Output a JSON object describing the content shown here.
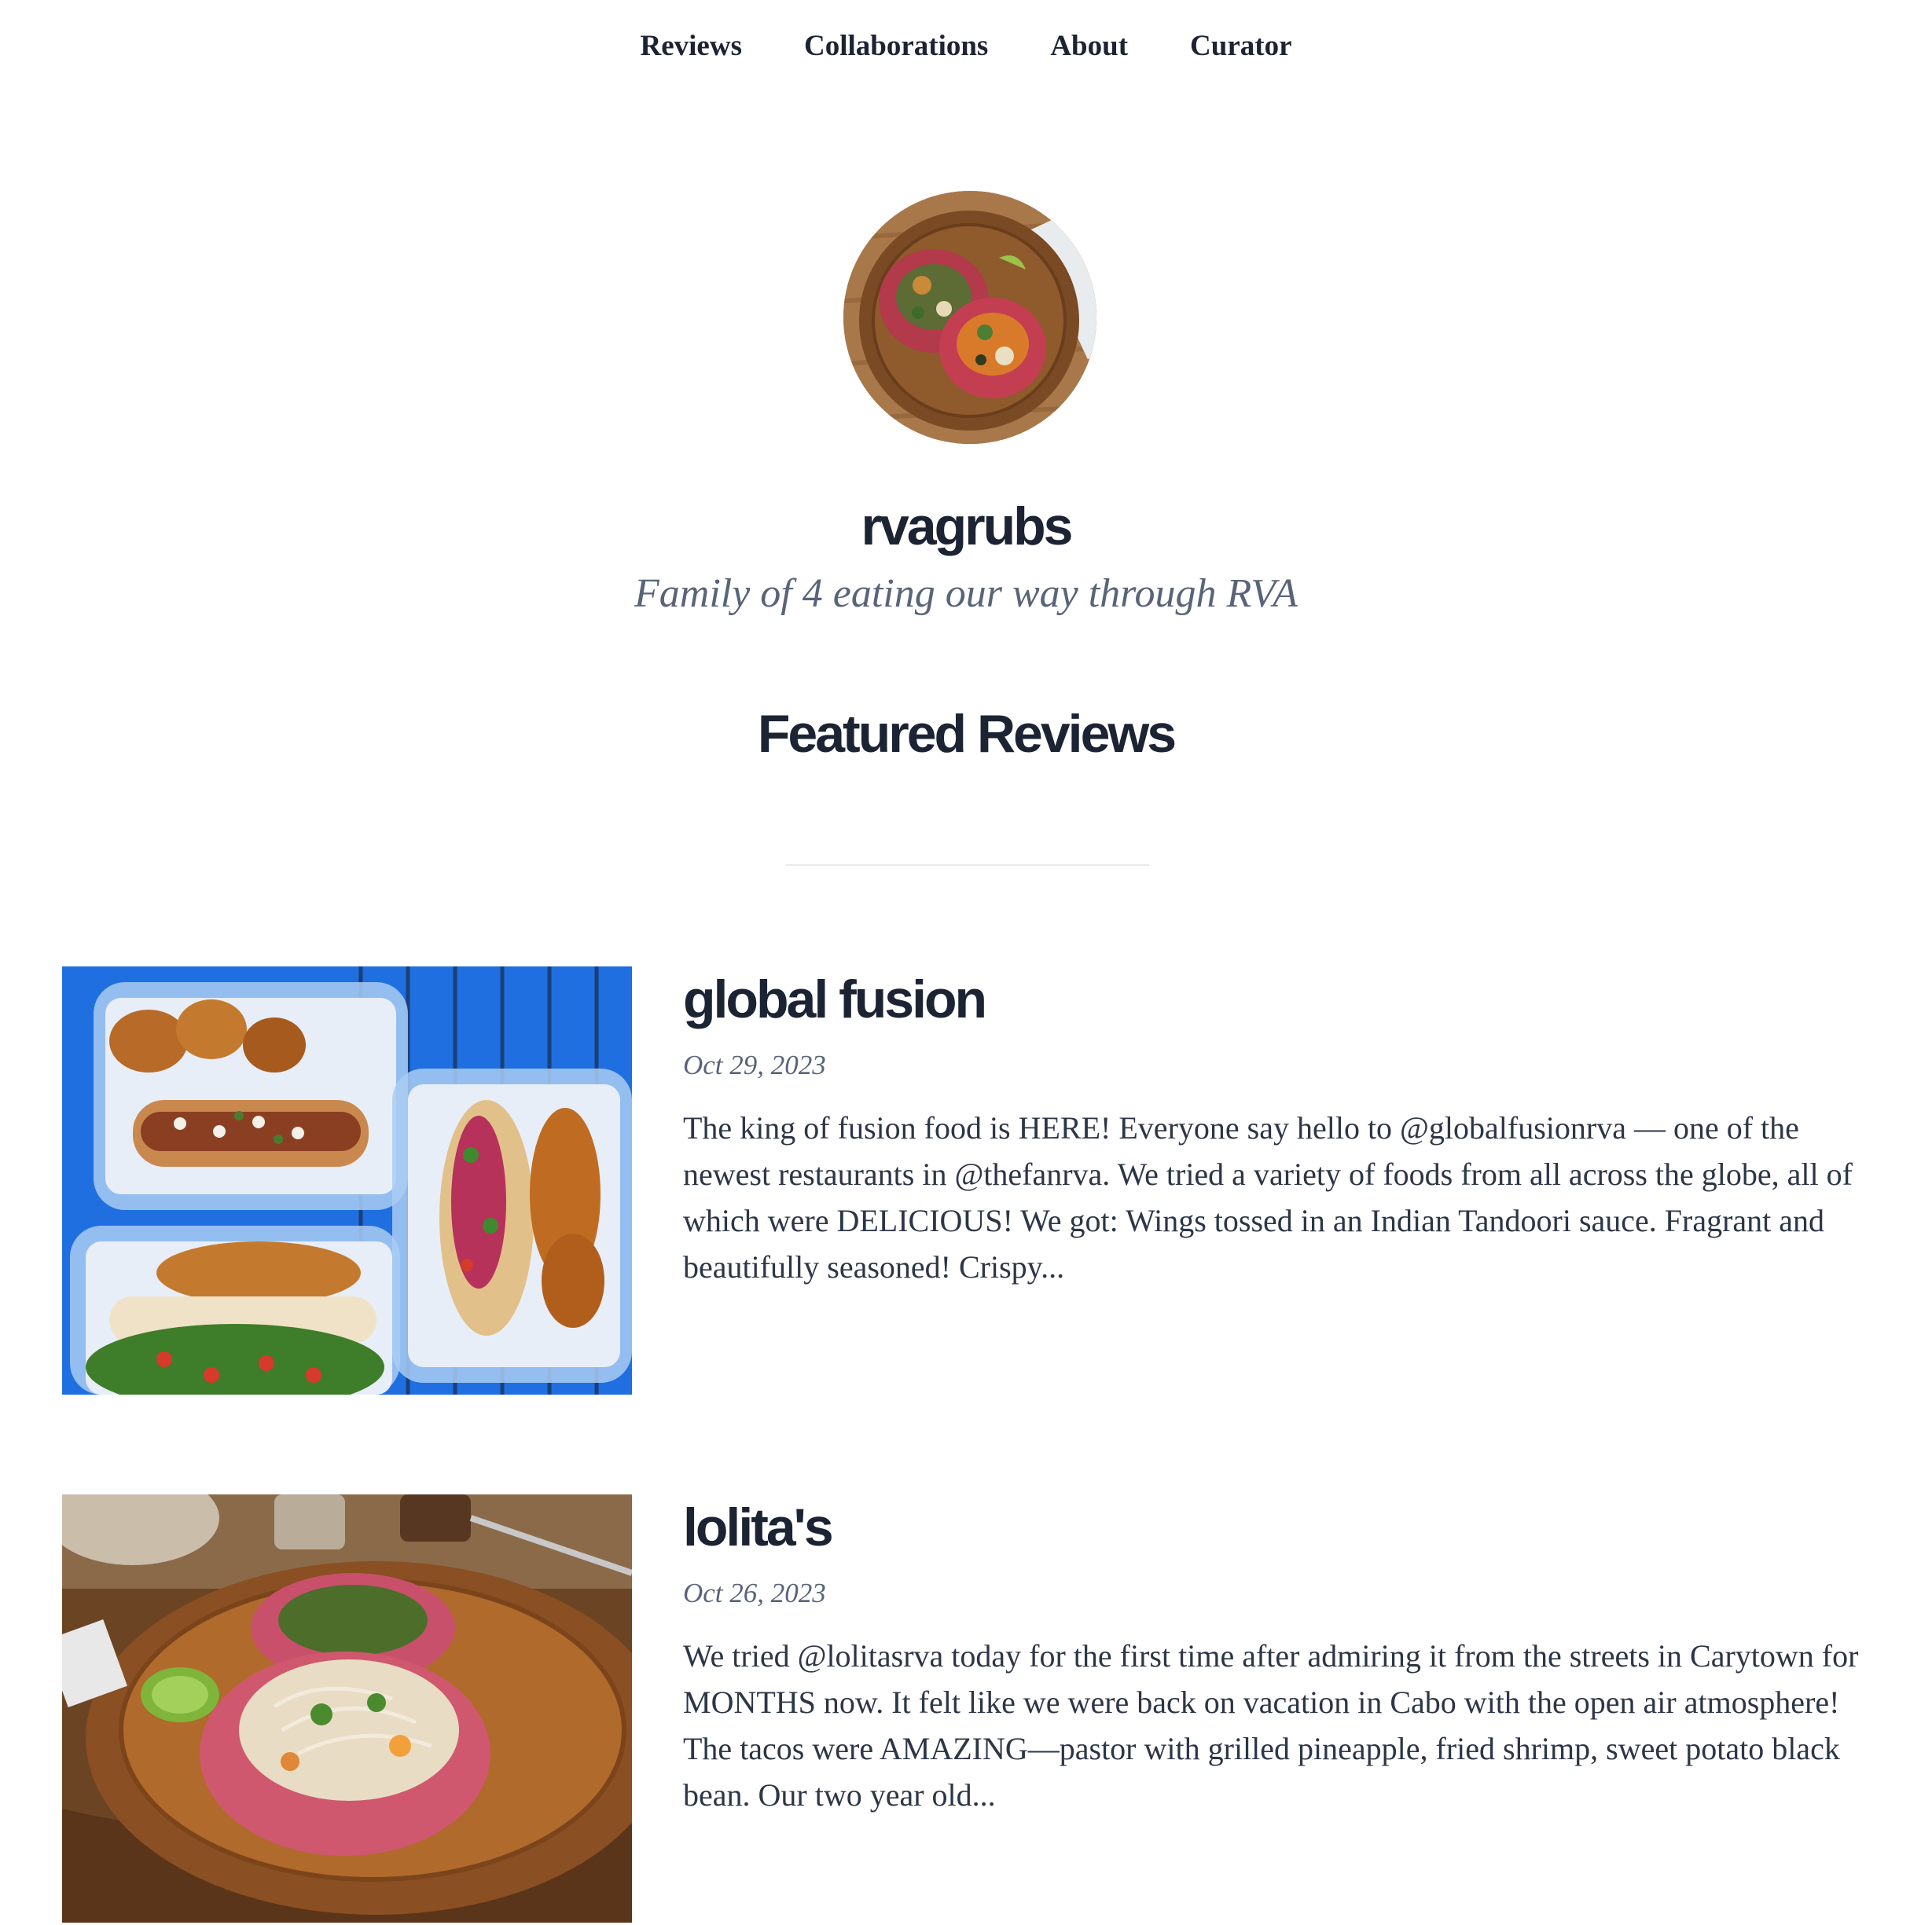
{
  "nav": {
    "items": [
      {
        "label": "Reviews"
      },
      {
        "label": "Collaborations"
      },
      {
        "label": "About"
      },
      {
        "label": "Curator"
      }
    ]
  },
  "profile": {
    "name": "rvagrubs",
    "tagline": "Family of 4 eating our way through RVA"
  },
  "featured": {
    "heading": "Featured Reviews",
    "reviews": [
      {
        "title": "global fusion",
        "date": "Oct 29, 2023",
        "excerpt": "The king of fusion food is HERE! Everyone say hello to @globalfusionrva — one of the newest restaurants in @thefanrva. We tried a variety of foods from all across the globe, all of which were DELICIOUS! We got: Wings tossed in an Indian Tandoori sauce. Fragrant and beautifully seasoned! Crispy..."
      },
      {
        "title": "lolita's",
        "date": "Oct 26, 2023",
        "excerpt": "We tried @lolitasrva today for the first time after admiring it from the streets in Carytown for MONTHS now. It felt like we were back on vacation in Cabo with the open air atmosphere! The tacos were AMAZING—pastor with grilled pineapple, fried shrimp, sweet potato black bean. Our two year old..."
      }
    ]
  },
  "colors": {
    "text": "#1c2433",
    "muted": "#5a6478",
    "body": "#2d3646",
    "divider": "#e6e8ec"
  }
}
